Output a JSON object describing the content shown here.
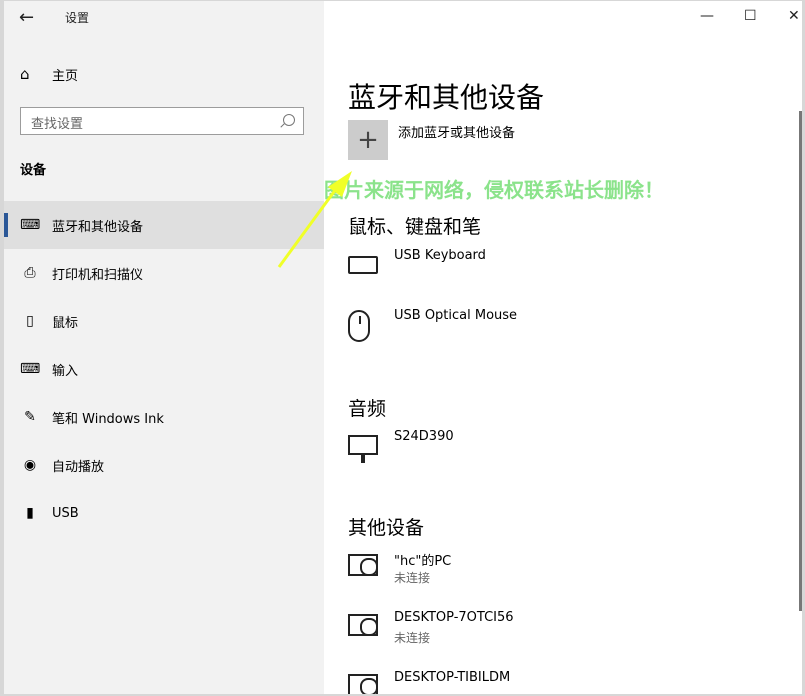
{
  "window": {
    "title": "设置",
    "controls": {
      "minimize": "—",
      "maximize": "☐",
      "close": "✕"
    }
  },
  "sidebar": {
    "home": {
      "label": "主页",
      "icon": "home-icon"
    },
    "search": {
      "placeholder": "查找设置"
    },
    "section": "设备",
    "items": [
      {
        "label": "蓝牙和其他设备",
        "icon": "bluetooth-devices-icon",
        "active": true
      },
      {
        "label": "打印机和扫描仪",
        "icon": "printer-icon",
        "active": false
      },
      {
        "label": "鼠标",
        "icon": "mouse-icon",
        "active": false
      },
      {
        "label": "输入",
        "icon": "keyboard-icon",
        "active": false
      },
      {
        "label": "笔和 Windows Ink",
        "icon": "pen-icon",
        "active": false
      },
      {
        "label": "自动播放",
        "icon": "autoplay-icon",
        "active": false
      },
      {
        "label": "USB",
        "icon": "usb-icon",
        "active": false
      }
    ]
  },
  "main": {
    "title": "蓝牙和其他设备",
    "add_device": {
      "label": "添加蓝牙或其他设备",
      "icon": "plus-icon"
    },
    "watermark": "图片来源于网络，侵权联系站长删除！",
    "groups": {
      "mouse_keyboard": {
        "title": "鼠标、键盘和笔",
        "devices": [
          {
            "name": "USB Keyboard",
            "icon": "keyboard-icon"
          },
          {
            "name": "USB Optical Mouse",
            "icon": "mouse-icon"
          }
        ]
      },
      "audio": {
        "title": "音频",
        "devices": [
          {
            "name": "S24D390",
            "icon": "monitor-icon"
          }
        ]
      },
      "other": {
        "title": "其他设备",
        "devices": [
          {
            "name": "\"hc\"的PC",
            "status": "未连接",
            "icon": "network-pc-icon"
          },
          {
            "name": "DESKTOP-7OTCI56",
            "status": "未连接",
            "icon": "network-pc-icon"
          },
          {
            "name": "DESKTOP-TIBILDM",
            "status": "",
            "icon": "network-pc-icon"
          }
        ]
      }
    }
  }
}
